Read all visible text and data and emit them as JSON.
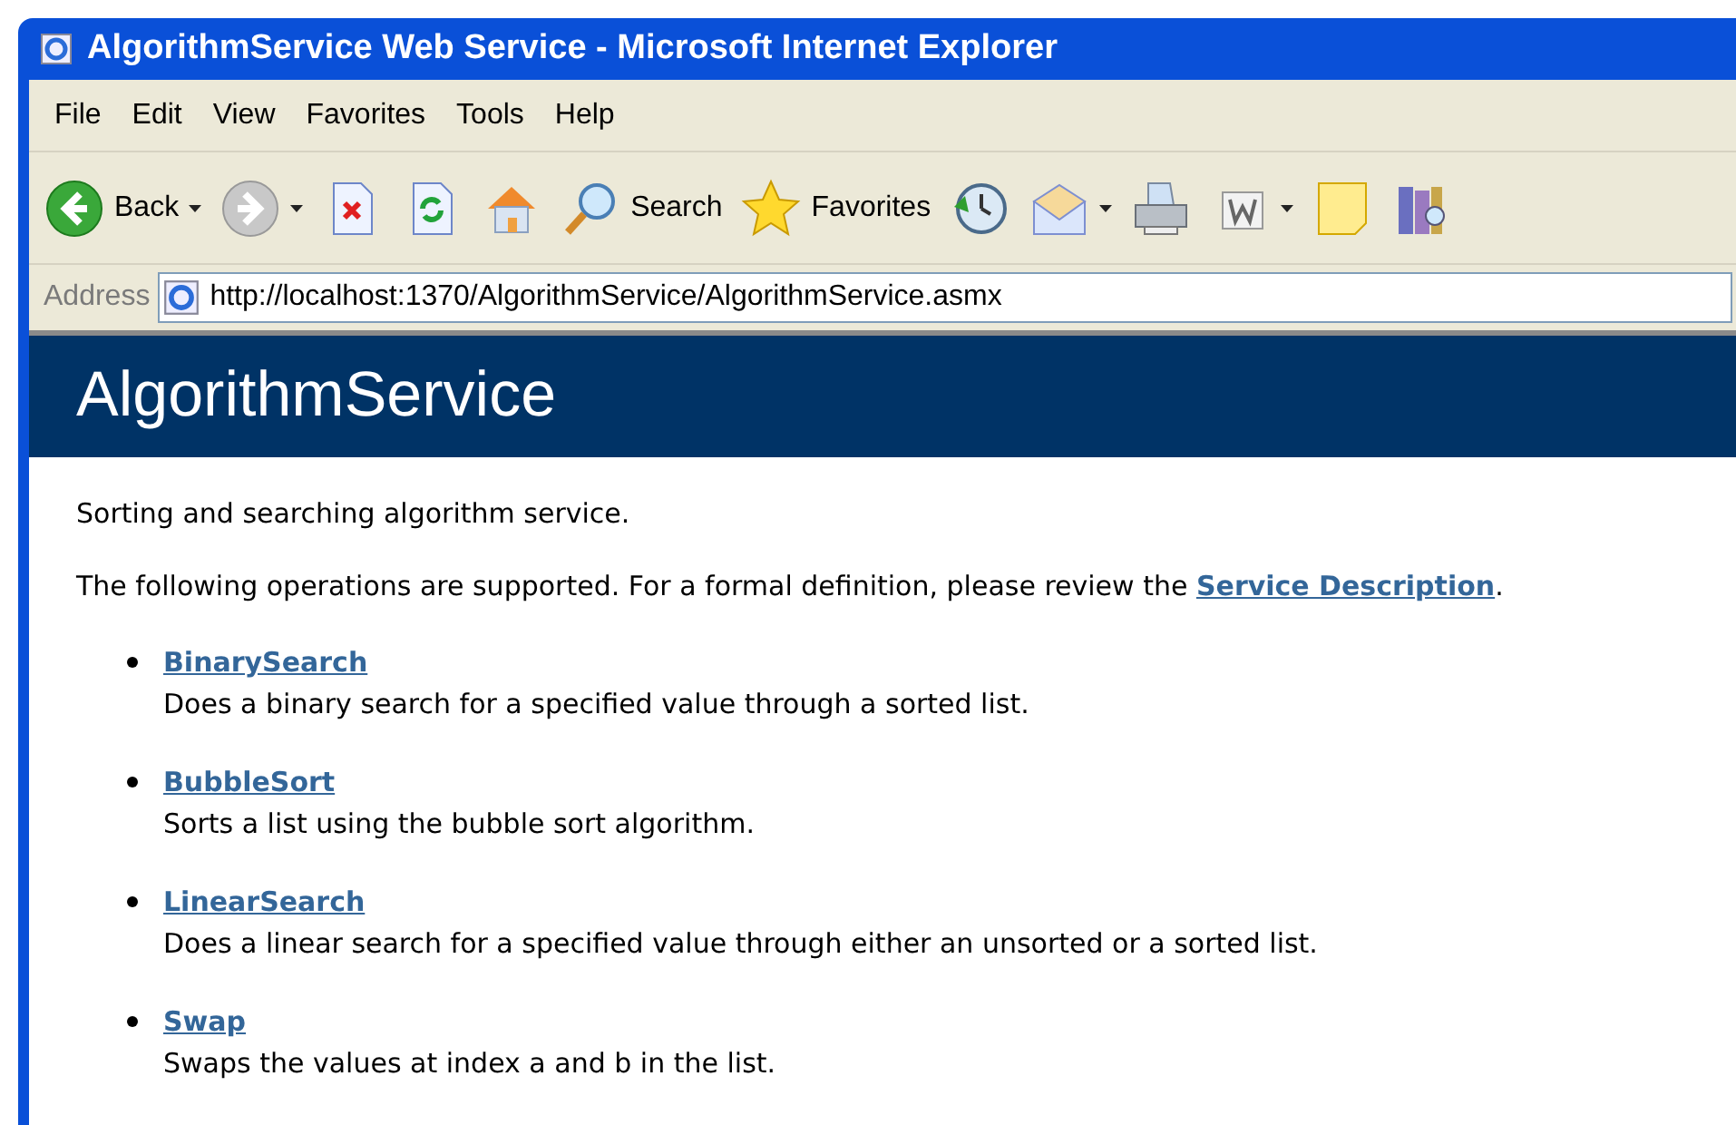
{
  "window": {
    "title": "AlgorithmService Web Service - Microsoft Internet Explorer"
  },
  "menu": [
    "File",
    "Edit",
    "View",
    "Favorites",
    "Tools",
    "Help"
  ],
  "toolbar": [
    {
      "kind": "back",
      "label": "Back",
      "disabled": false
    },
    {
      "kind": "forward",
      "disabled": true
    },
    {
      "kind": "stop"
    },
    {
      "kind": "refresh"
    },
    {
      "kind": "home"
    },
    {
      "kind": "search",
      "label": "Search"
    },
    {
      "kind": "favorites",
      "label": "Favorites"
    },
    {
      "kind": "history"
    },
    {
      "kind": "mail"
    },
    {
      "kind": "print"
    },
    {
      "kind": "edit"
    },
    {
      "kind": "note"
    },
    {
      "kind": "research"
    }
  ],
  "address": {
    "label": "Address",
    "value": "http://localhost:1370/AlgorithmService/AlgorithmService.asmx"
  },
  "page": {
    "heading": "AlgorithmService",
    "intro": "Sorting and searching algorithm service.",
    "operations_text": "The following operations are supported. For a formal definition, please review the ",
    "description_link": "Service Description",
    "operations_end": ".",
    "operations": [
      {
        "name": "BinarySearch",
        "description": "Does a binary search for a specified value through a sorted list."
      },
      {
        "name": "BubbleSort",
        "description": "Sorts a list using the bubble sort algorithm."
      },
      {
        "name": "LinearSearch",
        "description": "Does a linear search for a specified value through either an unsorted or a sorted list."
      },
      {
        "name": "Swap",
        "description": "Swaps the values at index a and b in the list."
      }
    ]
  }
}
